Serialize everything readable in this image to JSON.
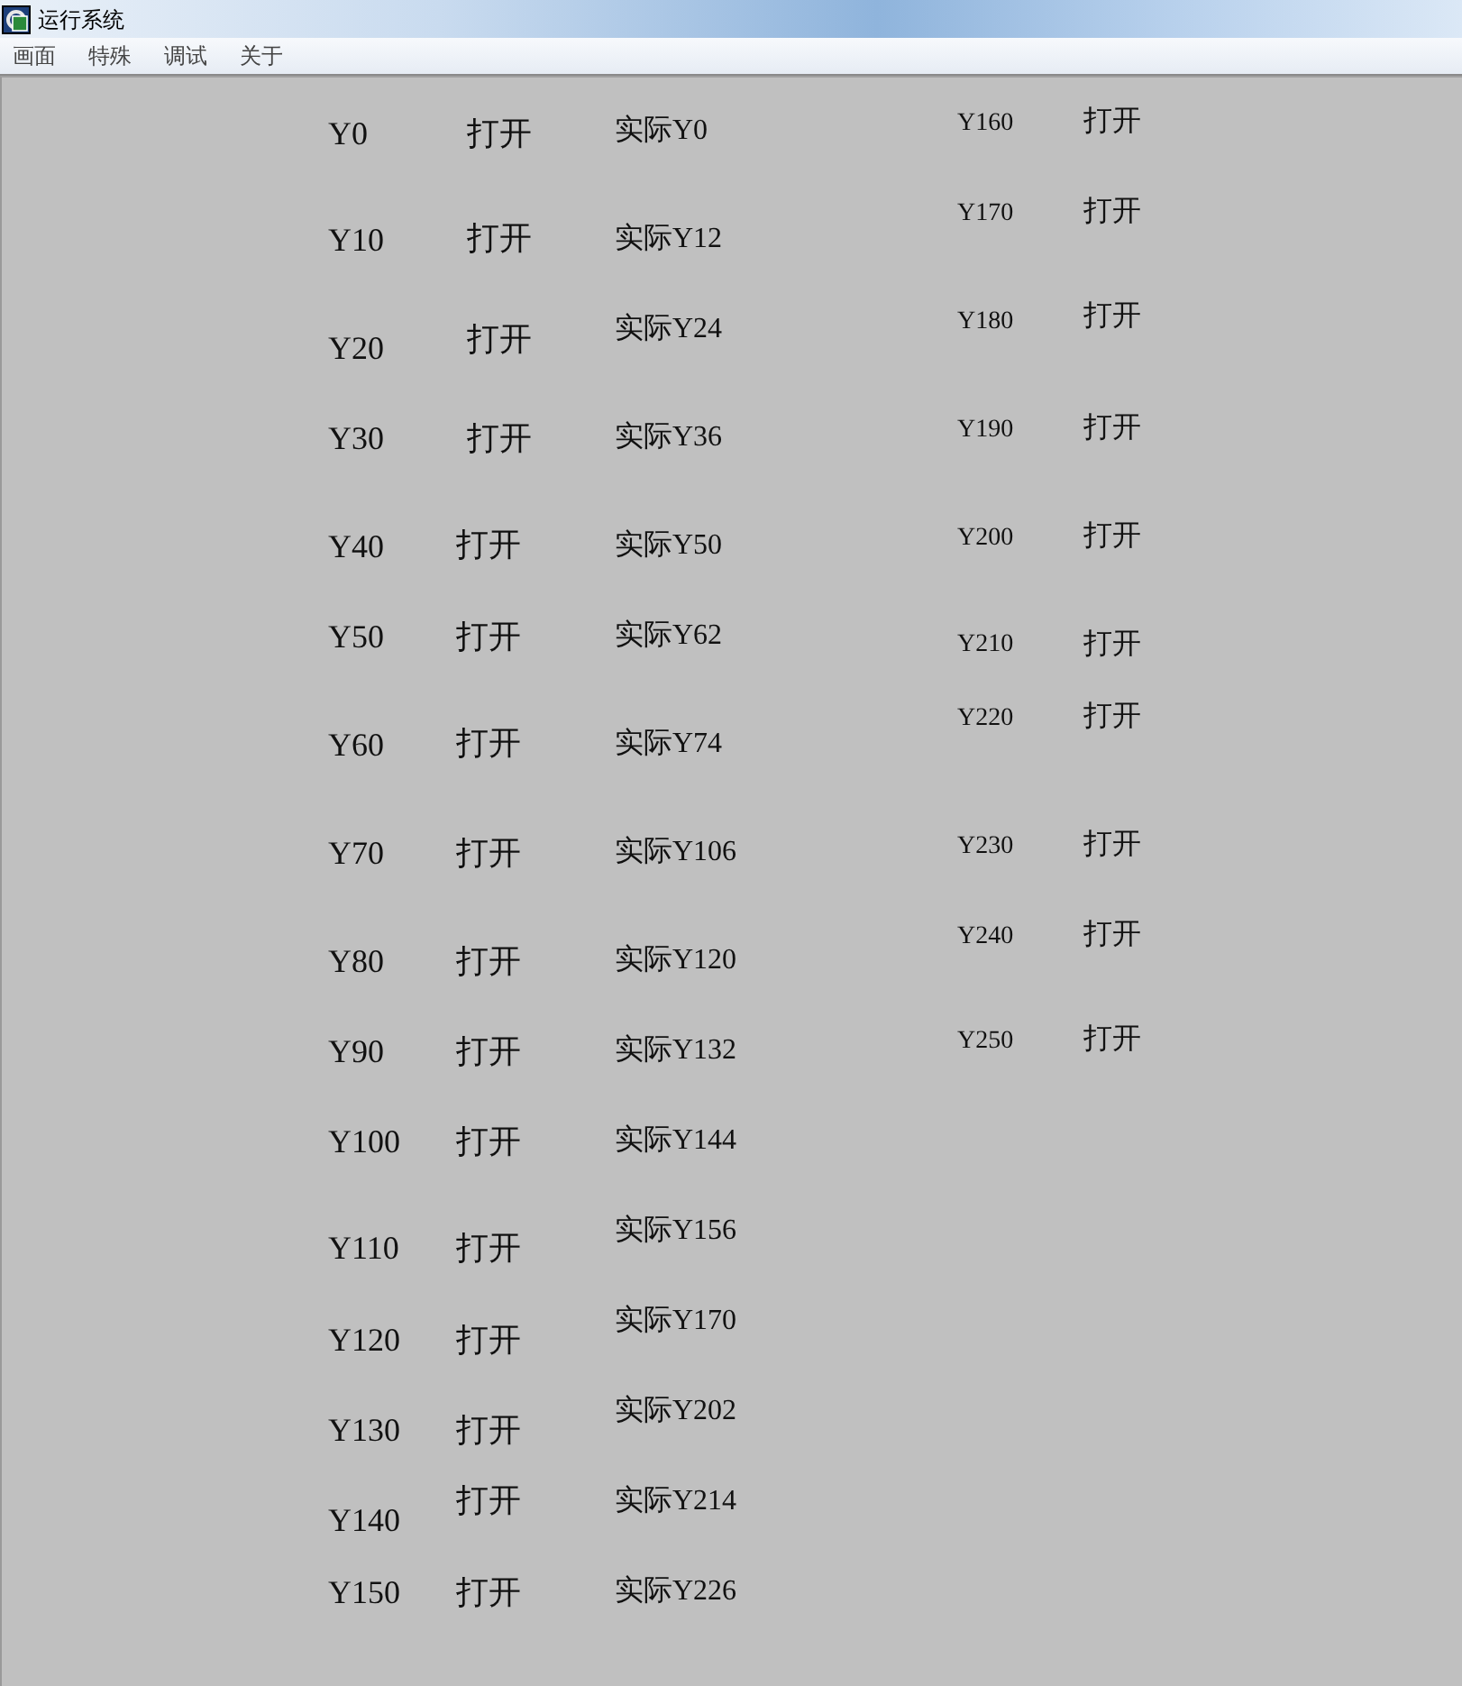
{
  "window": {
    "title": "运行系统"
  },
  "menu": [
    {
      "label": "画面"
    },
    {
      "label": "特殊"
    },
    {
      "label": "调试"
    },
    {
      "label": "关于"
    }
  ],
  "left_rows": [
    {
      "address": "Y0",
      "state": "打开",
      "actual": "实际Y0"
    },
    {
      "address": "Y10",
      "state": "打开",
      "actual": "实际Y12"
    },
    {
      "address": "Y20",
      "state": "打开",
      "actual": "实际Y24"
    },
    {
      "address": "Y30",
      "state": "打开",
      "actual": "实际Y36"
    },
    {
      "address": "Y40",
      "state": "打开",
      "actual": "实际Y50"
    },
    {
      "address": "Y50",
      "state": "打开",
      "actual": "实际Y62"
    },
    {
      "address": "Y60",
      "state": "打开",
      "actual": "实际Y74"
    },
    {
      "address": "Y70",
      "state": "打开",
      "actual": "实际Y106"
    },
    {
      "address": "Y80",
      "state": "打开",
      "actual": "实际Y120"
    },
    {
      "address": "Y90",
      "state": "打开",
      "actual": "实际Y132"
    },
    {
      "address": "Y100",
      "state": "打开",
      "actual": "实际Y144"
    },
    {
      "address": "Y110",
      "state": "打开",
      "actual": "实际Y156"
    },
    {
      "address": "Y120",
      "state": "打开",
      "actual": "实际Y170"
    },
    {
      "address": "Y130",
      "state": "打开",
      "actual": "实际Y202"
    },
    {
      "address": "Y140",
      "state": "打开",
      "actual": "实际Y214"
    },
    {
      "address": "Y150",
      "state": "打开",
      "actual": "实际Y226"
    }
  ],
  "right_rows": [
    {
      "address": "Y160",
      "state": "打开"
    },
    {
      "address": "Y170",
      "state": "打开"
    },
    {
      "address": "Y180",
      "state": "打开"
    },
    {
      "address": "Y190",
      "state": "打开"
    },
    {
      "address": "Y200",
      "state": "打开"
    },
    {
      "address": "Y210",
      "state": "打开"
    },
    {
      "address": "Y220",
      "state": "打开"
    },
    {
      "address": "Y230",
      "state": "打开"
    },
    {
      "address": "Y240",
      "state": "打开"
    },
    {
      "address": "Y250",
      "state": "打开"
    }
  ]
}
